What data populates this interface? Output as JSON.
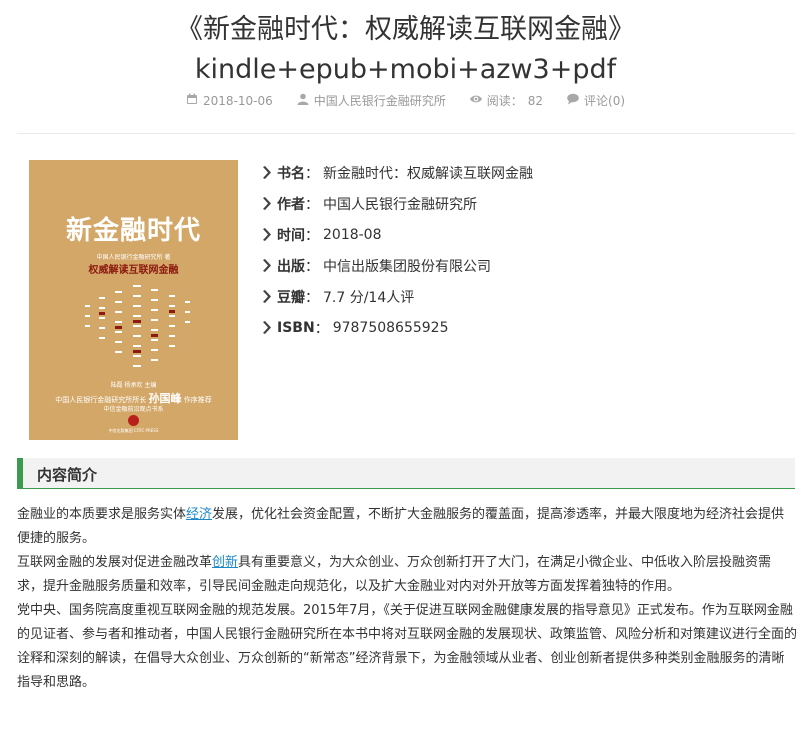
{
  "article": {
    "title_line1": "《新金融时代：权威解读互联网金融》",
    "title_line2": "kindle+epub+mobi+azw3+pdf",
    "meta": {
      "date": "2018-10-06",
      "author": "中国人民银行金融研究所",
      "views_label": "阅读：",
      "views": "82",
      "comments": "评论(0)"
    }
  },
  "cover": {
    "title": "新金融时代",
    "small_line": "中国人民银行金融研究所 著",
    "subtitle": "权威解读互联网金融",
    "editors": "陆磊 杨承欢 主编",
    "chief_prefix": "中国人民银行金融研究所所长",
    "chief_name": "孙国峰",
    "chief_suffix": "作序推荐",
    "series": "中信金融前沿观点书系",
    "publisher": "中信出版集团 CITIC PRESS",
    "colors": {
      "background": "#d3a767",
      "accent": "#8b1a10"
    }
  },
  "book_info": [
    {
      "label": "书名",
      "value": "新金融时代：权威解读互联网金融"
    },
    {
      "label": "作者",
      "value": "中国人民银行金融研究所"
    },
    {
      "label": "时间",
      "value": "2018-08"
    },
    {
      "label": "出版",
      "value": "中信出版集团股份有限公司"
    },
    {
      "label": "豆瓣",
      "value": "7.7 分/14人评"
    },
    {
      "label": "ISBN",
      "value": "9787508655925"
    }
  ],
  "section": {
    "title": "内容简介"
  },
  "content": {
    "p1_a": "金融业的本质要求是服务实体",
    "p1_link": "经济",
    "p1_b": "发展，优化社会资金配置，不断扩大金融服务的覆盖面，提高渗透率，并最大限度地为经济社会提供便捷的服务。",
    "p2_a": "互联网金融的发展对促进金融改革",
    "p2_link": "创新",
    "p2_b": "具有重要意义，为大众创业、万众创新打开了大门，在满足小微企业、中低收入阶层投融资需求，提升金融服务质量和效率，引导民间金融走向规范化，以及扩大金融业对内对外开放等方面发挥着独特的作用。",
    "p3": "党中央、国务院高度重视互联网金融的规范发展。2015年7月，《关于促进互联网金融健康发展的指导意见》正式发布。作为互联网金融的见证者、参与者和推动者，中国人民银行金融研究所在本书中将对互联网金融的发展现状、政策监管、风险分析和对策建议进行全面的诠释和深刻的解读，在倡导大众创业、万众创新的“新常态”经济背景下，为金融领域从业者、创业创新者提供多种类别金融服务的清晰指导和思路。"
  },
  "colors": {
    "accent": "#3a9b4f",
    "link": "#1e88c7",
    "meta_text": "#999999"
  }
}
